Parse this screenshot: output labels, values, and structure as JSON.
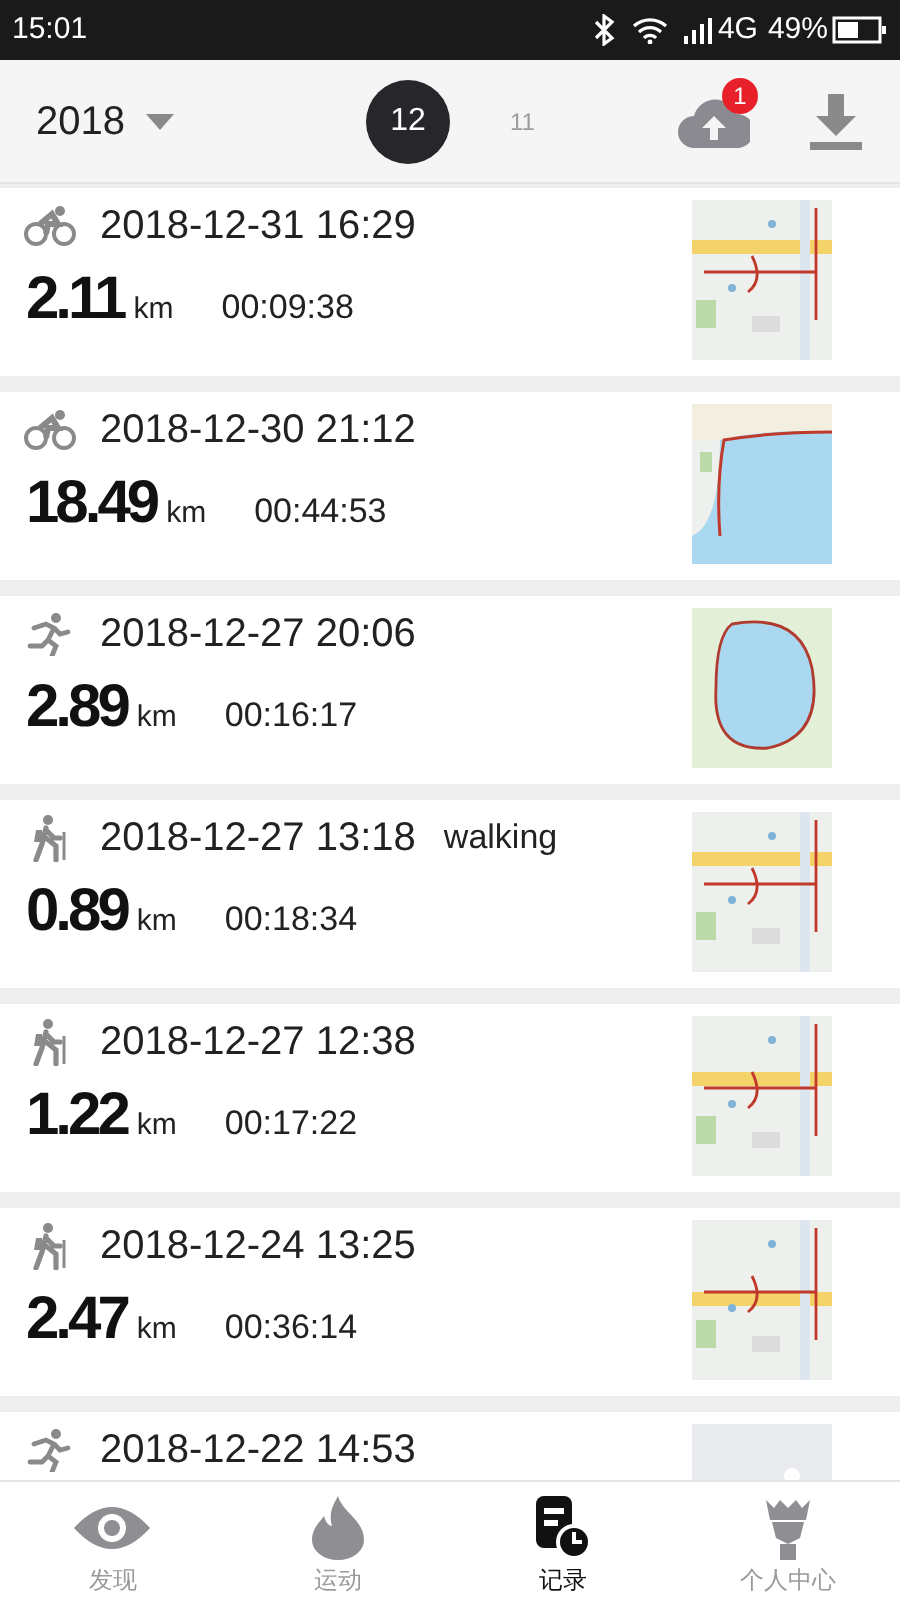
{
  "status_bar": {
    "time": "15:01",
    "network": "4G",
    "battery": "49%"
  },
  "header": {
    "year": "2018",
    "months": [
      {
        "label": "12",
        "selected": true
      },
      {
        "label": "11",
        "selected": false
      }
    ],
    "upload_badge": "1"
  },
  "records": [
    {
      "kind": "bike",
      "datetime": "2018-12-31 16:29",
      "distance": "2.11",
      "unit": "km",
      "duration": "00:09:38"
    },
    {
      "kind": "bike",
      "datetime": "2018-12-30 21:12",
      "distance": "18.49",
      "unit": "km",
      "duration": "00:44:53"
    },
    {
      "kind": "run",
      "datetime": "2018-12-27 20:06",
      "distance": "2.89",
      "unit": "km",
      "duration": "00:16:17"
    },
    {
      "kind": "hike",
      "datetime": "2018-12-27 13:18",
      "note": "walking",
      "distance": "0.89",
      "unit": "km",
      "duration": "00:18:34"
    },
    {
      "kind": "hike",
      "datetime": "2018-12-27 12:38",
      "distance": "1.22",
      "unit": "km",
      "duration": "00:17:22"
    },
    {
      "kind": "hike",
      "datetime": "2018-12-24 13:25",
      "distance": "2.47",
      "unit": "km",
      "duration": "00:36:14"
    },
    {
      "kind": "run",
      "datetime": "2018-12-22 14:53"
    }
  ],
  "tabs": [
    {
      "kind": "eye",
      "label": "发现",
      "selected": false
    },
    {
      "kind": "flame",
      "label": "运动",
      "selected": false
    },
    {
      "kind": "record",
      "label": "记录",
      "selected": true
    },
    {
      "kind": "figure",
      "label": "个人中心",
      "selected": false
    }
  ]
}
